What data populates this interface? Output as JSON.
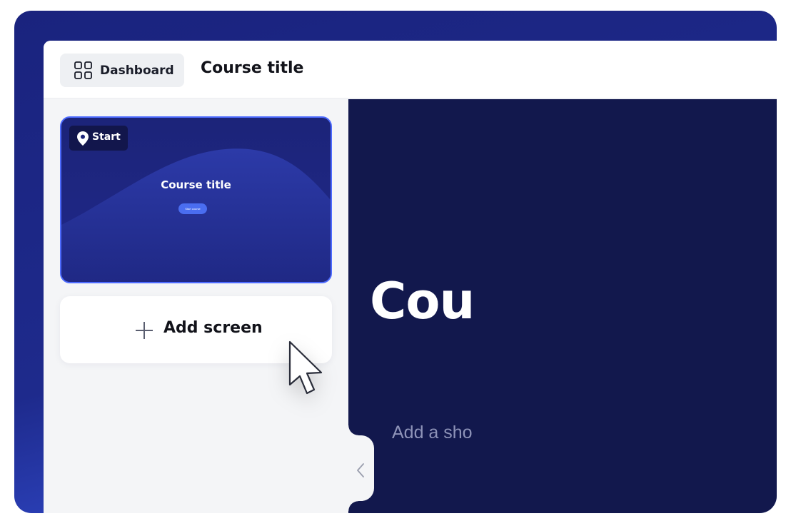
{
  "topbar": {
    "dashboard_label": "Dashboard",
    "dashboard_icon": "grid-icon",
    "course_title": "Course title"
  },
  "sidebar": {
    "screens": [
      {
        "badge_label": "Start",
        "badge_icon": "location-pin-icon",
        "title": "Course title",
        "button_label": "Start course",
        "selected": true
      }
    ],
    "add_screen_label": "Add screen",
    "add_screen_icon": "plus-icon",
    "collapse_icon": "chevron-left-icon"
  },
  "canvas": {
    "title_visible": "Cou",
    "subtitle_visible": "Add a sho"
  },
  "colors": {
    "accent": "#4d6bff",
    "frame_gradient_top": "#1a237e",
    "frame_gradient_bottom": "#3b5cf0",
    "canvas_bg": "#12184d",
    "sidebar_bg": "#f4f5f7"
  }
}
